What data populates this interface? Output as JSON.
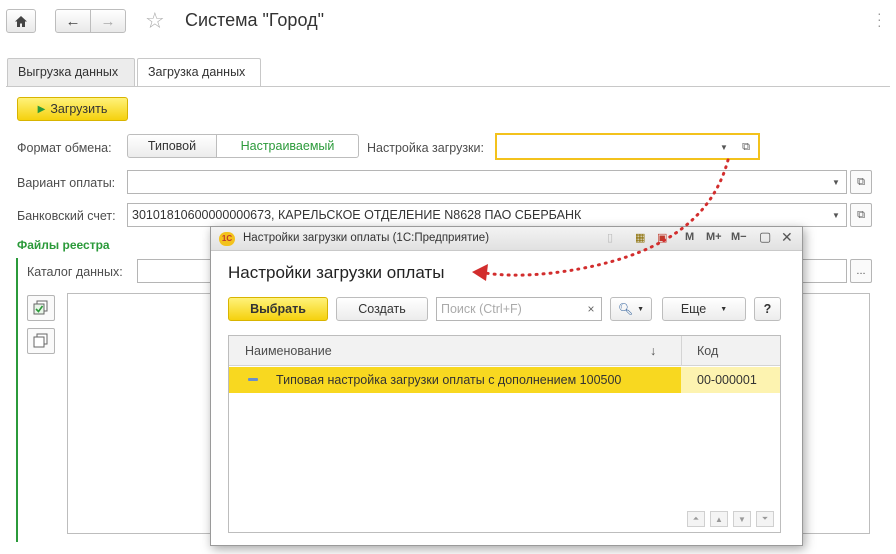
{
  "app": {
    "title": "Система \"Город\"",
    "star_icon": "☆"
  },
  "tabs": [
    {
      "label": "Выгрузка данных"
    },
    {
      "label": "Загрузка данных"
    }
  ],
  "form": {
    "load_button": "Загрузить",
    "exchange_format_label": "Формат обмена:",
    "format_options": [
      "Типовой",
      "Настраиваемый"
    ],
    "format_selected": "Настраиваемый",
    "load_settings_label": "Настройка загрузки:",
    "load_settings_value": "",
    "payment_variant_label": "Вариант оплаты:",
    "payment_variant_value": "",
    "bank_account_label": "Банковский счет:",
    "bank_account_value": "30101810600000000673, КАРЕЛЬСКОЕ ОТДЕЛЕНИЕ N8628 ПАО СБЕРБАНК",
    "registry_section": "Файлы реестра",
    "data_catalog_label": "Каталог данных:",
    "data_catalog_value": "",
    "browse_button": "..."
  },
  "modal": {
    "window_title": "Настройки загрузки оплаты  (1С:Предприятие)",
    "logo": "1С",
    "heading": "Настройки загрузки оплаты",
    "toolbar": {
      "select": "Выбрать",
      "create": "Создать",
      "search_placeholder": "Поиск (Ctrl+F)",
      "clear": "×",
      "more": "Еще",
      "help": "?"
    },
    "title_buttons": {
      "m": "M",
      "m_plus": "M+",
      "m_minus": "M−"
    },
    "columns": {
      "name": "Наименование",
      "code": "Код",
      "sort_indicator": "↓"
    },
    "rows": [
      {
        "name": "Типовая настройка загрузки оплаты с дополнением 100500",
        "code": "00-000001"
      }
    ]
  },
  "colors": {
    "accent_yellow": "#f5d10e",
    "section_green": "#2b9a3a",
    "arrow_red": "#d22d2d"
  }
}
